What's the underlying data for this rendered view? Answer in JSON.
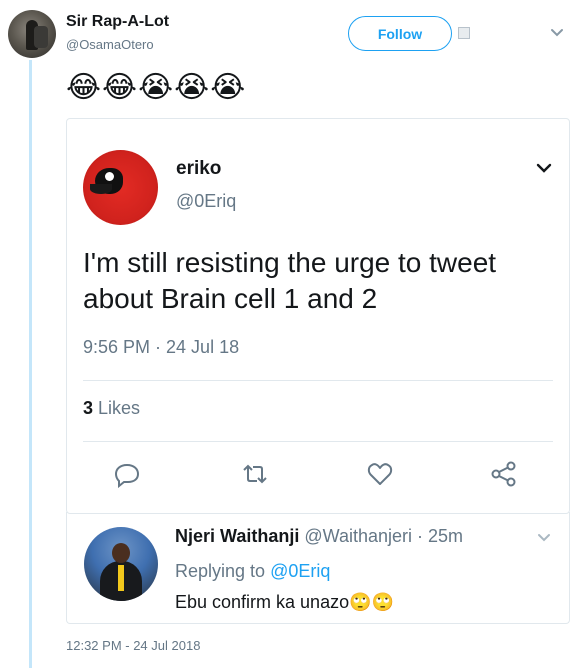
{
  "tweet": {
    "author_name": "Sir Rap-A-Lot",
    "author_handle": "@OsamaOtero",
    "follow_label": "Follow",
    "emojis": "😂😂😭😭😭",
    "timestamp": "12:32 PM - 24 Jul 2018"
  },
  "quoted": {
    "name": "eriko",
    "handle": "@0Eriq",
    "text": "I'm still resisting the urge to tweet about Brain cell 1 and 2",
    "time": "9:56 PM · 24 Jul 18",
    "likes_count": "3",
    "likes_label": "Likes"
  },
  "reply": {
    "name": "Njeri Waithanji",
    "handle_time": "@Waithanjeri · 25m",
    "replying_to_label": "Replying to",
    "replying_to_handle": "@0Eriq",
    "text": "Ebu confirm ka unazo🙄🙄"
  },
  "icons": [
    "caret-down-icon",
    "reply-icon",
    "retweet-icon",
    "like-icon",
    "share-icon",
    "note-icon"
  ],
  "colors": {
    "accent": "#1da1f2",
    "thread_line": "#c4e6fa",
    "muted": "#657786",
    "text": "#14171a",
    "border": "#e1e8ed"
  }
}
